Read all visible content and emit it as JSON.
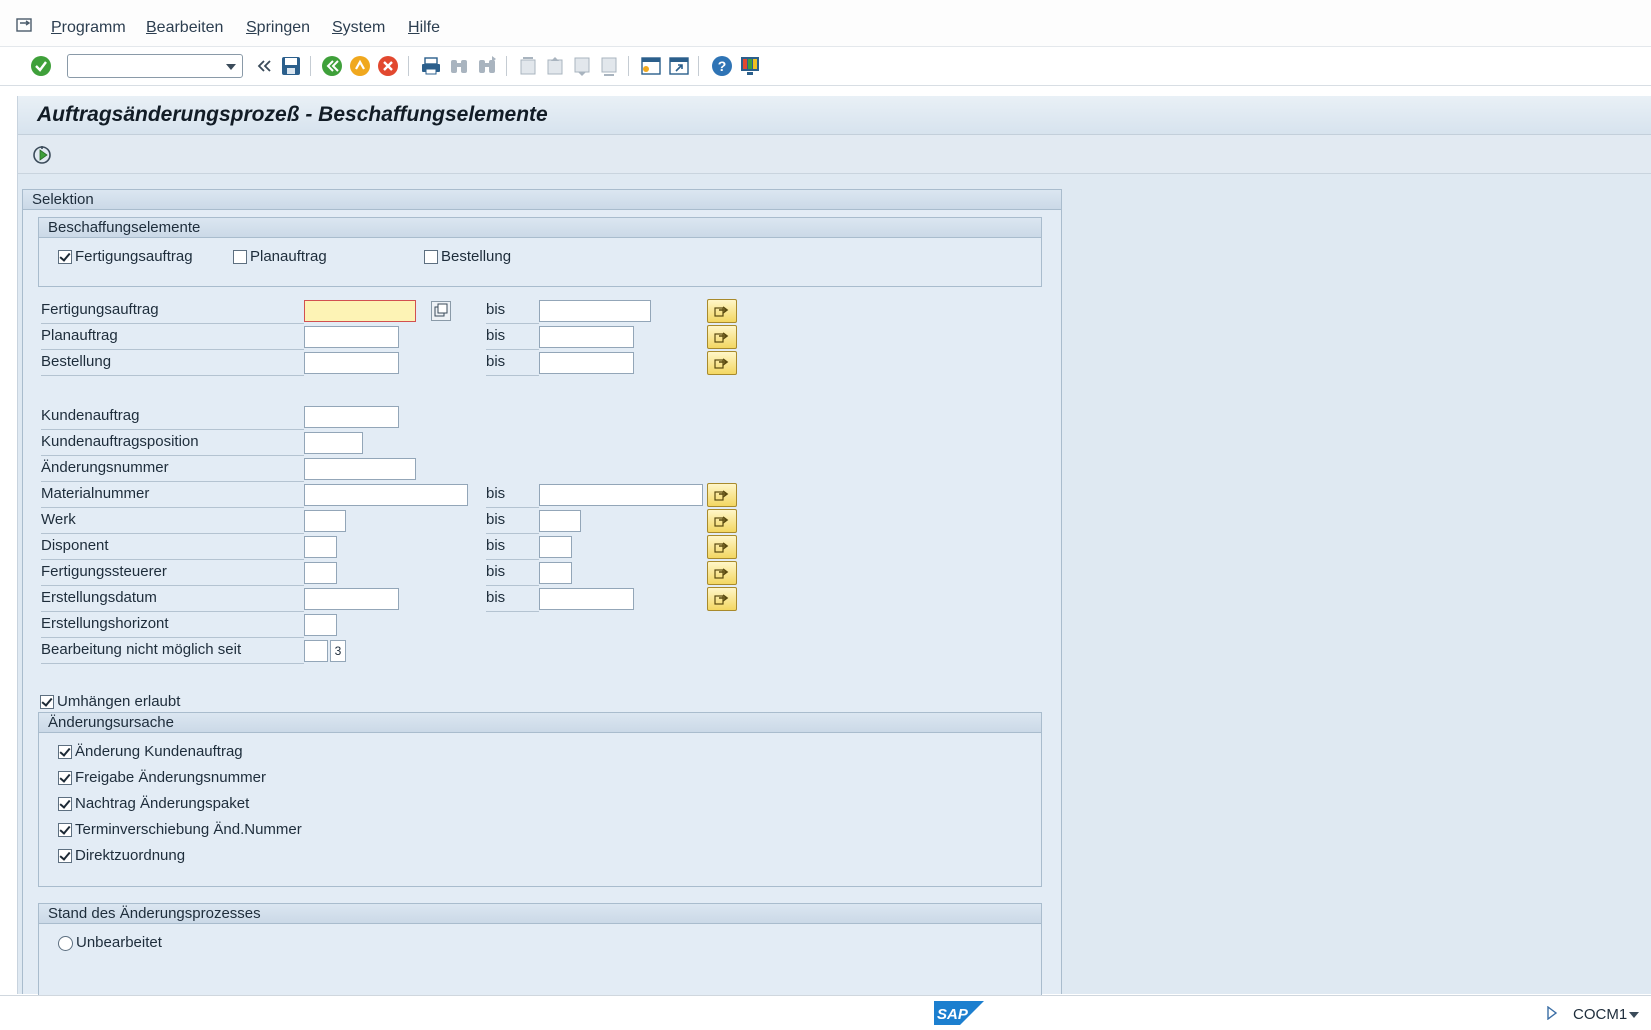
{
  "menu": {
    "items": [
      {
        "label": "Programm",
        "hotkey": "P",
        "rest": "rogramm"
      },
      {
        "label": "Bearbeiten",
        "hotkey": "B",
        "rest": "earbeiten"
      },
      {
        "label": "Springen",
        "hotkey": "S",
        "rest": "pringen"
      },
      {
        "label": "System",
        "hotkey": "S",
        "rest": "ystem"
      },
      {
        "label": "Hilfe",
        "hotkey": "H",
        "rest": "ilfe"
      }
    ]
  },
  "toolbar": {
    "command_field_value": "",
    "icons": [
      "enter-icon",
      "back-double-icon",
      "save-icon",
      "back-icon",
      "exit-icon",
      "cancel-icon",
      "print-icon",
      "find-icon",
      "find-next-icon",
      "first-page-icon",
      "previous-page-icon",
      "next-page-icon",
      "last-page-icon",
      "new-session-icon",
      "create-shortcut-icon",
      "help-icon",
      "customize-layout-icon"
    ]
  },
  "page": {
    "title": "Auftragsänderungsprozeß - Beschaffungselemente"
  },
  "selection": {
    "header": "Selektion",
    "procurement": {
      "header": "Beschaffungselemente",
      "options": [
        {
          "label": "Fertigungsauftrag",
          "checked": true
        },
        {
          "label": "Planauftrag",
          "checked": false
        },
        {
          "label": "Bestellung",
          "checked": false
        }
      ]
    },
    "bis_label": "bis",
    "fields": {
      "fertigungsauftrag": {
        "label": "Fertigungsauftrag",
        "from": "",
        "to": ""
      },
      "planauftrag": {
        "label": "Planauftrag",
        "from": "",
        "to": ""
      },
      "bestellung": {
        "label": "Bestellung",
        "from": "",
        "to": ""
      },
      "kundenauftrag": {
        "label": "Kundenauftrag",
        "value": ""
      },
      "kundenauftragsposition": {
        "label": "Kundenauftragsposition",
        "value": ""
      },
      "aenderungsnummer": {
        "label": "Änderungsnummer",
        "value": ""
      },
      "materialnummer": {
        "label": "Materialnummer",
        "from": "",
        "to": ""
      },
      "werk": {
        "label": "Werk",
        "from": "",
        "to": ""
      },
      "disponent": {
        "label": "Disponent",
        "from": "",
        "to": ""
      },
      "fertigungssteuerer": {
        "label": "Fertigungssteuerer",
        "from": "",
        "to": ""
      },
      "erstellungsdatum": {
        "label": "Erstellungsdatum",
        "from": "",
        "to": ""
      },
      "erstellungshorizont": {
        "label": "Erstellungshorizont",
        "value": ""
      },
      "bearbeitung": {
        "label": "Bearbeitung nicht möglich seit",
        "value": "",
        "suffix": "3"
      }
    },
    "umhaengen": {
      "label": "Umhängen erlaubt",
      "checked": true
    },
    "cause": {
      "header": "Änderungsursache",
      "options": [
        {
          "label": "Änderung Kundenauftrag",
          "checked": true
        },
        {
          "label": "Freigabe Änderungsnummer",
          "checked": true
        },
        {
          "label": "Nachtrag Änderungspaket",
          "checked": true
        },
        {
          "label": "Terminverschiebung Änd.Nummer",
          "checked": true
        },
        {
          "label": "Direktzuordnung",
          "checked": true
        }
      ]
    },
    "status": {
      "header": "Stand des Änderungsprozesses",
      "options": [
        {
          "label": "Unbearbeitet",
          "selected": false
        }
      ]
    }
  },
  "statusbar": {
    "logo_text": "SAP",
    "transaction": "COCM1"
  }
}
